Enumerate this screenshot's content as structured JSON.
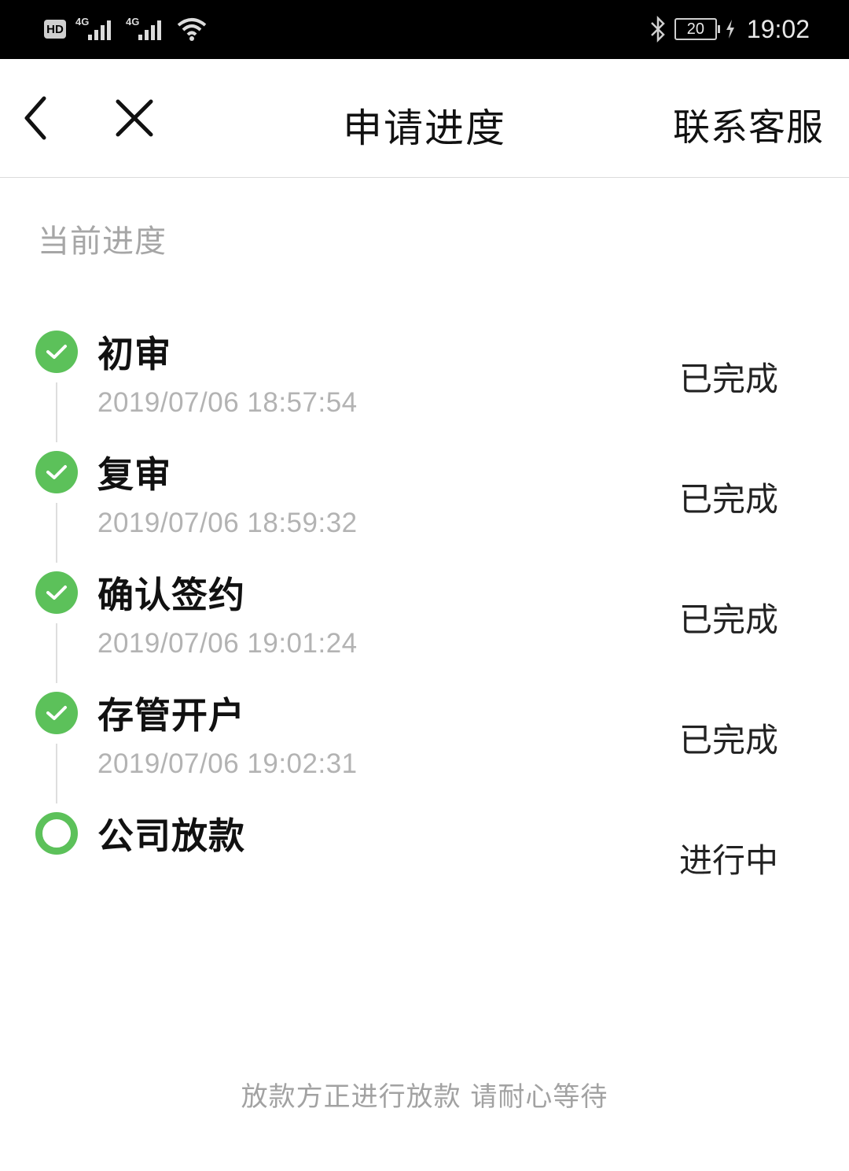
{
  "status_bar": {
    "hd_label": "HD",
    "network_1": "4G",
    "network_2": "4G",
    "battery_level": "20",
    "time": "19:02"
  },
  "nav": {
    "back_icon": "chevron-left-icon",
    "close_icon": "close-icon",
    "title": "申请进度",
    "contact_label": "联系客服"
  },
  "section": {
    "label": "当前进度"
  },
  "steps": [
    {
      "title": "初审",
      "time": "2019/07/06 18:57:54",
      "status": "已完成",
      "done": true
    },
    {
      "title": "复审",
      "time": "2019/07/06 18:59:32",
      "status": "已完成",
      "done": true
    },
    {
      "title": "确认签约",
      "time": "2019/07/06 19:01:24",
      "status": "已完成",
      "done": true
    },
    {
      "title": "存管开户",
      "time": "2019/07/06 19:02:31",
      "status": "已完成",
      "done": true
    },
    {
      "title": "公司放款",
      "time": "",
      "status": "进行中",
      "done": false
    }
  ],
  "footer": {
    "note": "放款方正进行放款 请耐心等待"
  },
  "colors": {
    "accent_green": "#5cc15a",
    "muted_text": "#a6a6a6",
    "status_bar_bg": "#000000"
  }
}
